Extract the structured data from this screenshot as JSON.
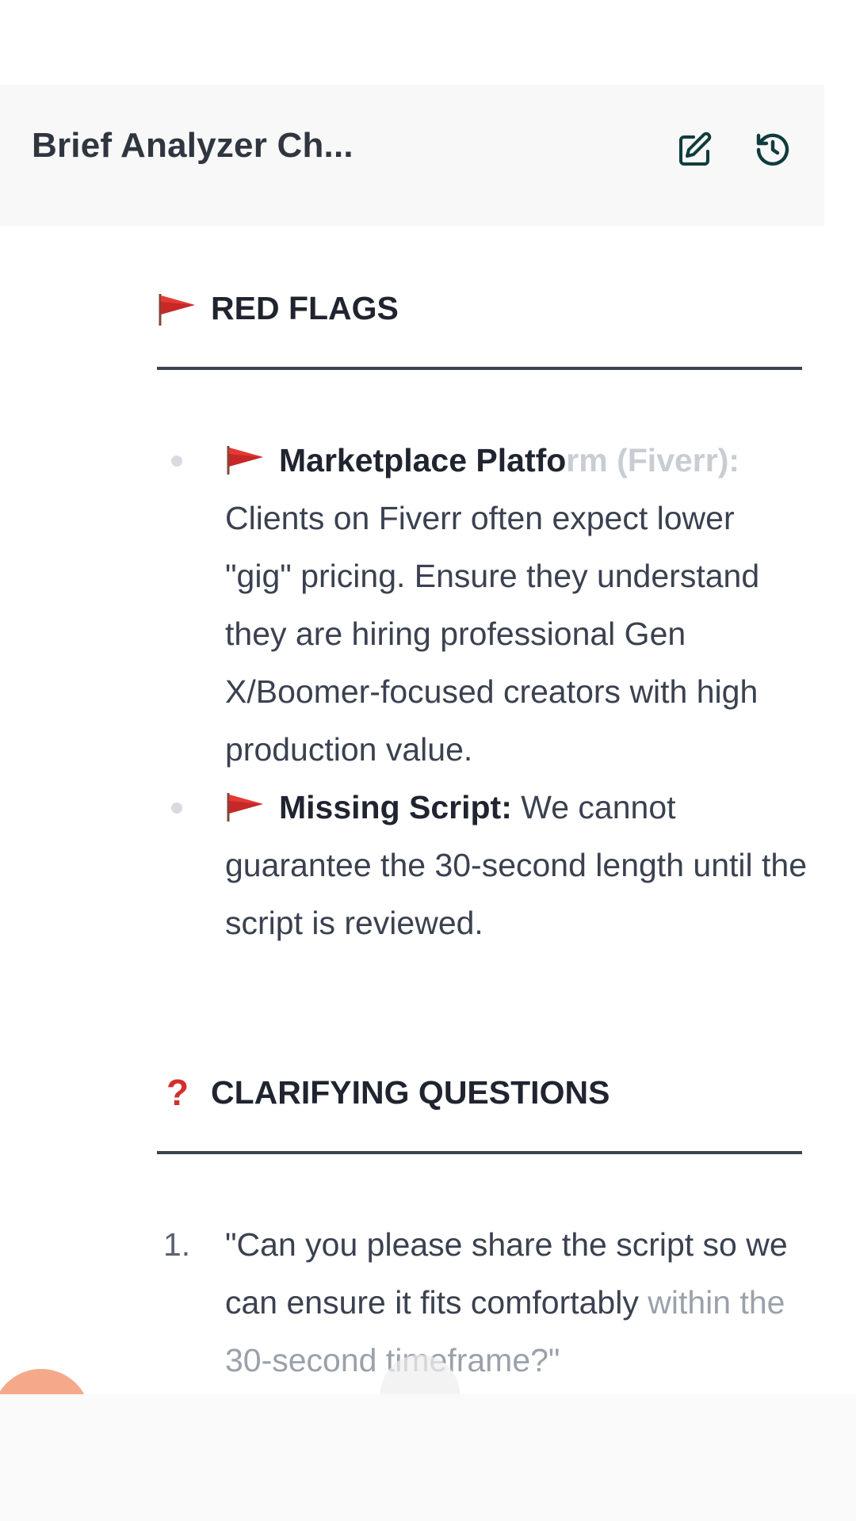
{
  "header": {
    "title": "Brief Analyzer Ch..."
  },
  "sections": {
    "red_flags": {
      "emoji": "🚩",
      "heading": "RED FLAGS",
      "items": [
        {
          "title_a": "Marketplace Platfo",
          "title_b": "rm (Fiverr):",
          "body": "Clients on Fiverr often expect lower \"gig\" pricing. Ensure they understand they are hiring professional Gen X/Boomer-focused creators with high production value."
        },
        {
          "title": "Missing Script:",
          "body": "We cannot guarantee the 30-second length until the script is reviewed."
        }
      ]
    },
    "clarifying_questions": {
      "emoji": "❓",
      "heading": "CLARIFYING QUESTIONS",
      "items": [
        {
          "number": "1.",
          "text_main": "\"Can you please share the script so we can ensure it fits comfortably",
          "text_fade": "within the 30-second timeframe?\""
        }
      ]
    }
  },
  "colors": {
    "header_bg": "#f8f8f8",
    "accent_icon": "#0f3d3e",
    "flag_red": "#c62828",
    "fab_orange": "#f4a98b"
  },
  "icons": {
    "edit": "edit-square-icon",
    "history": "history-icon",
    "flag": "red-flag-icon"
  }
}
